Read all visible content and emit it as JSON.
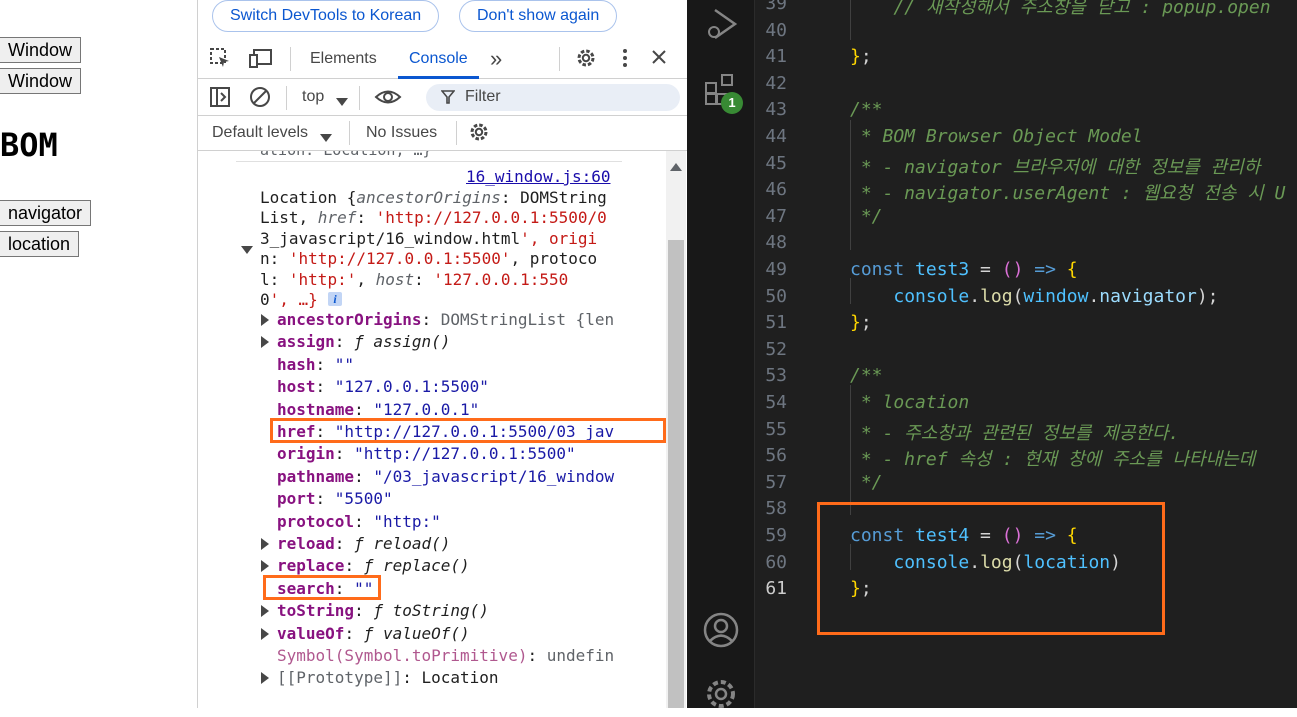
{
  "page": {
    "buttons": [
      "Window",
      "Window",
      "navigator",
      "location"
    ],
    "heading": "BOM"
  },
  "devtools": {
    "lang_buttons": {
      "switch": "Switch DevTools to Korean",
      "dont_show": "Don't show again"
    },
    "tabs": {
      "elements": "Elements",
      "console": "Console",
      "more": "»"
    },
    "toolbar": {
      "context": "top",
      "filter_placeholder": "Filter",
      "levels": "Default levels",
      "issues": "No Issues"
    },
    "console": {
      "cutoff_line": "ation: Location, …}",
      "source_link": "16_window.js:60",
      "summary_lines": [
        "Location {ancestorOrigins: DOMString",
        "List, href: 'http://127.0.0.1:5500/0",
        "3_javascript/16_window.html', origi",
        "n: 'http://127.0.0.1:5500', protoco",
        "l: 'http:', host: '127.0.0.1:550",
        "0', …}"
      ],
      "info_badge": "i",
      "properties": [
        {
          "key": "ancestorOrigins",
          "value": "DOMStringList {len",
          "expandable": true,
          "kind": "obj"
        },
        {
          "key": "assign",
          "value": "ƒ assign()",
          "expandable": true,
          "kind": "fn"
        },
        {
          "key": "hash",
          "value": "\"\"",
          "expandable": false,
          "kind": "str"
        },
        {
          "key": "host",
          "value": "\"127.0.0.1:5500\"",
          "expandable": false,
          "kind": "str"
        },
        {
          "key": "hostname",
          "value": "\"127.0.0.1\"",
          "expandable": false,
          "kind": "str"
        },
        {
          "key": "href",
          "value": "\"http://127.0.0.1:5500/03_jav",
          "expandable": false,
          "kind": "str"
        },
        {
          "key": "origin",
          "value": "\"http://127.0.0.1:5500\"",
          "expandable": false,
          "kind": "str"
        },
        {
          "key": "pathname",
          "value": "\"/03_javascript/16_window",
          "expandable": false,
          "kind": "str"
        },
        {
          "key": "port",
          "value": "\"5500\"",
          "expandable": false,
          "kind": "str"
        },
        {
          "key": "protocol",
          "value": "\"http:\"",
          "expandable": false,
          "kind": "str"
        },
        {
          "key": "reload",
          "value": "ƒ reload()",
          "expandable": true,
          "kind": "fn"
        },
        {
          "key": "replace",
          "value": "ƒ replace()",
          "expandable": true,
          "kind": "fn"
        },
        {
          "key": "search",
          "value": "\"\"",
          "expandable": false,
          "kind": "str"
        },
        {
          "key": "toString",
          "value": "ƒ toString()",
          "expandable": true,
          "kind": "fn"
        },
        {
          "key": "valueOf",
          "value": "ƒ valueOf()",
          "expandable": true,
          "kind": "fn"
        },
        {
          "key": "Symbol(Symbol.toPrimitive)",
          "value": "undefin",
          "expandable": false,
          "kind": "sym"
        },
        {
          "key": "[[Prototype]]",
          "value": "Location",
          "expandable": true,
          "kind": "proto"
        }
      ]
    }
  },
  "editor": {
    "badge_count": "1",
    "lines": [
      {
        "num": "39",
        "code": "    // 새작성해서 주소창을 닫고 : popup.open"
      },
      {
        "num": "40",
        "code": ""
      },
      {
        "num": "41",
        "code": "};"
      },
      {
        "num": "42",
        "code": ""
      },
      {
        "num": "43",
        "code": "/**"
      },
      {
        "num": "44",
        "code": " * BOM Browser Object Model"
      },
      {
        "num": "45",
        "code": " * - navigator 브라우저에 대한 정보를 관리하"
      },
      {
        "num": "46",
        "code": " * - navigator.userAgent : 웹요청 전송 시 U"
      },
      {
        "num": "47",
        "code": " */"
      },
      {
        "num": "48",
        "code": ""
      },
      {
        "num": "49",
        "code": "const test3 = () => {"
      },
      {
        "num": "50",
        "code": "    console.log(window.navigator);"
      },
      {
        "num": "51",
        "code": "};"
      },
      {
        "num": "52",
        "code": ""
      },
      {
        "num": "53",
        "code": "/**"
      },
      {
        "num": "54",
        "code": " * location"
      },
      {
        "num": "55",
        "code": " * - 주소창과 관련된 정보를 제공한다."
      },
      {
        "num": "56",
        "code": " * - href 속성 : 현재 창에 주소를 나타내는데"
      },
      {
        "num": "57",
        "code": " */"
      },
      {
        "num": "58",
        "code": ""
      },
      {
        "num": "59",
        "code": "const test4 = () => {"
      },
      {
        "num": "60",
        "code": "    console.log(location)"
      },
      {
        "num": "61",
        "code": "};"
      }
    ]
  },
  "colors": {
    "highlight": "#ff6b1a",
    "console_tab": "#0b57d0",
    "editor_bg": "#1f1f1f"
  }
}
